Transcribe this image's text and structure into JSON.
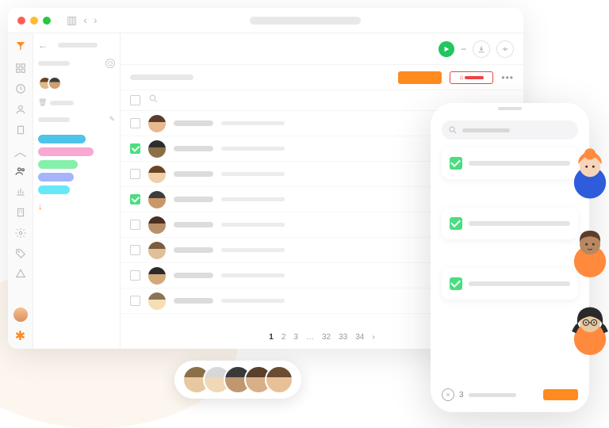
{
  "window": {
    "traffic": [
      "close",
      "minimize",
      "zoom"
    ],
    "nav_prev": "‹",
    "nav_next": "›"
  },
  "rail": {
    "logo": "app-logo",
    "icons": [
      "dashboard",
      "clock",
      "person",
      "clipboard",
      "divider",
      "users",
      "reports",
      "building",
      "settings",
      "tag",
      "filter"
    ]
  },
  "panel": {
    "back": "←",
    "gear": "settings",
    "tags": [
      "tag-1",
      "tag-2",
      "tag-3",
      "tag-4",
      "tag-5"
    ],
    "import_icon": "↓"
  },
  "toolbar": {
    "play": "play",
    "minus": "−",
    "btn1": "export",
    "btn2": "share"
  },
  "subbar": {
    "primary_btn": "",
    "secondary_btn": "",
    "lock_icon": "🔒",
    "more": "•••"
  },
  "list": {
    "rows": [
      {
        "checked": false,
        "avatar": "a1"
      },
      {
        "checked": true,
        "avatar": "a2"
      },
      {
        "checked": false,
        "avatar": "a3"
      },
      {
        "checked": true,
        "avatar": "a4"
      },
      {
        "checked": false,
        "avatar": "a5"
      },
      {
        "checked": false,
        "avatar": "a6"
      },
      {
        "checked": false,
        "avatar": "a7"
      },
      {
        "checked": false,
        "avatar": "a8"
      }
    ]
  },
  "pager": {
    "pages": [
      "1",
      "2",
      "3",
      "…",
      "32",
      "33",
      "34"
    ],
    "active": "1",
    "next": "›"
  },
  "strip": {
    "avatars": [
      "s1",
      "s2",
      "s3",
      "s4",
      "s5"
    ]
  },
  "phone": {
    "search_placeholder": "",
    "cards": [
      {
        "checked": true
      },
      {
        "checked": true
      },
      {
        "checked": true
      }
    ],
    "footer": {
      "count": "3",
      "close": "×"
    }
  }
}
